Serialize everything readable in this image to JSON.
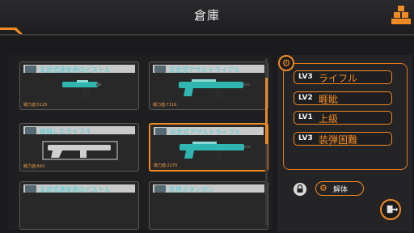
{
  "header": {
    "title": "倉庫",
    "accent_color": "#f08a22"
  },
  "grid": {
    "cards": [
      {
        "label": "玄武式護身用のピストル",
        "stat": "戦力値:5125",
        "weapon": "pistol",
        "selected": false
      },
      {
        "label": "玄武式アサルトライフル",
        "stat": "戦力値:7116",
        "weapon": "assault-rifle",
        "selected": false
      },
      {
        "label": "破損したライフル",
        "stat": "戦力値:643",
        "weapon": "rifle-damaged",
        "selected": false
      },
      {
        "label": "玄武式アサルトライフル",
        "stat": "戦力値:2270",
        "weapon": "assault-rifle",
        "selected": true
      },
      {
        "label": "玄武式護身用のピストル",
        "stat": "",
        "weapon": "pistol",
        "selected": false
      },
      {
        "label": "民用スタンガン",
        "stat": "",
        "weapon": "stun-gun",
        "selected": false
      }
    ]
  },
  "detail": {
    "stats": [
      {
        "level": "LV3",
        "text": "ライフル"
      },
      {
        "level": "LV2",
        "text": "睚眦"
      },
      {
        "level": "LV1",
        "text": "上級"
      },
      {
        "level": "LV3",
        "text": "装弾困難"
      }
    ],
    "dismantle_label": "解体"
  },
  "icons": {
    "header_right": "cubes-icon",
    "settings": "gear-icon",
    "lock": "lock-icon",
    "dismantle": "gear-icon",
    "exit": "exit-door-icon"
  }
}
